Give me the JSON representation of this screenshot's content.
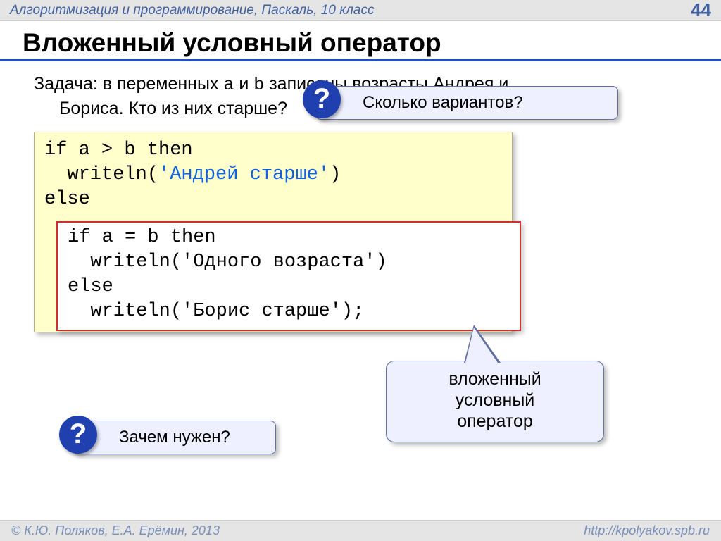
{
  "header": {
    "course": "Алгоритмизация и программирование, Паскаль, 10 класс",
    "page": "44"
  },
  "title": "Вложенный условный оператор",
  "task": {
    "label": "Задача:",
    "line1_rest": " в переменных ",
    "var_a": "a",
    "mid": " и ",
    "var_b": "b",
    "line1_tail": " записаны возрасты Андрея и",
    "line2": "Бориса. Кто из них старше?"
  },
  "callouts": {
    "q1": "Сколько вариантов?",
    "q2": "Зачем нужен?",
    "qmark": "?"
  },
  "code": {
    "l1a": "if a > b then",
    "l2a": "  writeln(",
    "s2": "'Андрей старше'",
    "l2b": ")",
    "l3": "else",
    "n1": "if a = b then",
    "n2a": "  writeln(",
    "ns2": "'Одного возраста'",
    "n2b": ")",
    "n3": "else",
    "n4a": "  writeln(",
    "ns4": "'Борис старше'",
    "n4b": ");"
  },
  "bubble": {
    "l1": "вложенный",
    "l2": "условный",
    "l3": "оператор"
  },
  "footer": {
    "copyright": "© К.Ю. Поляков, Е.А. Ерёмин, 2013",
    "url": "http://kpolyakov.spb.ru"
  }
}
